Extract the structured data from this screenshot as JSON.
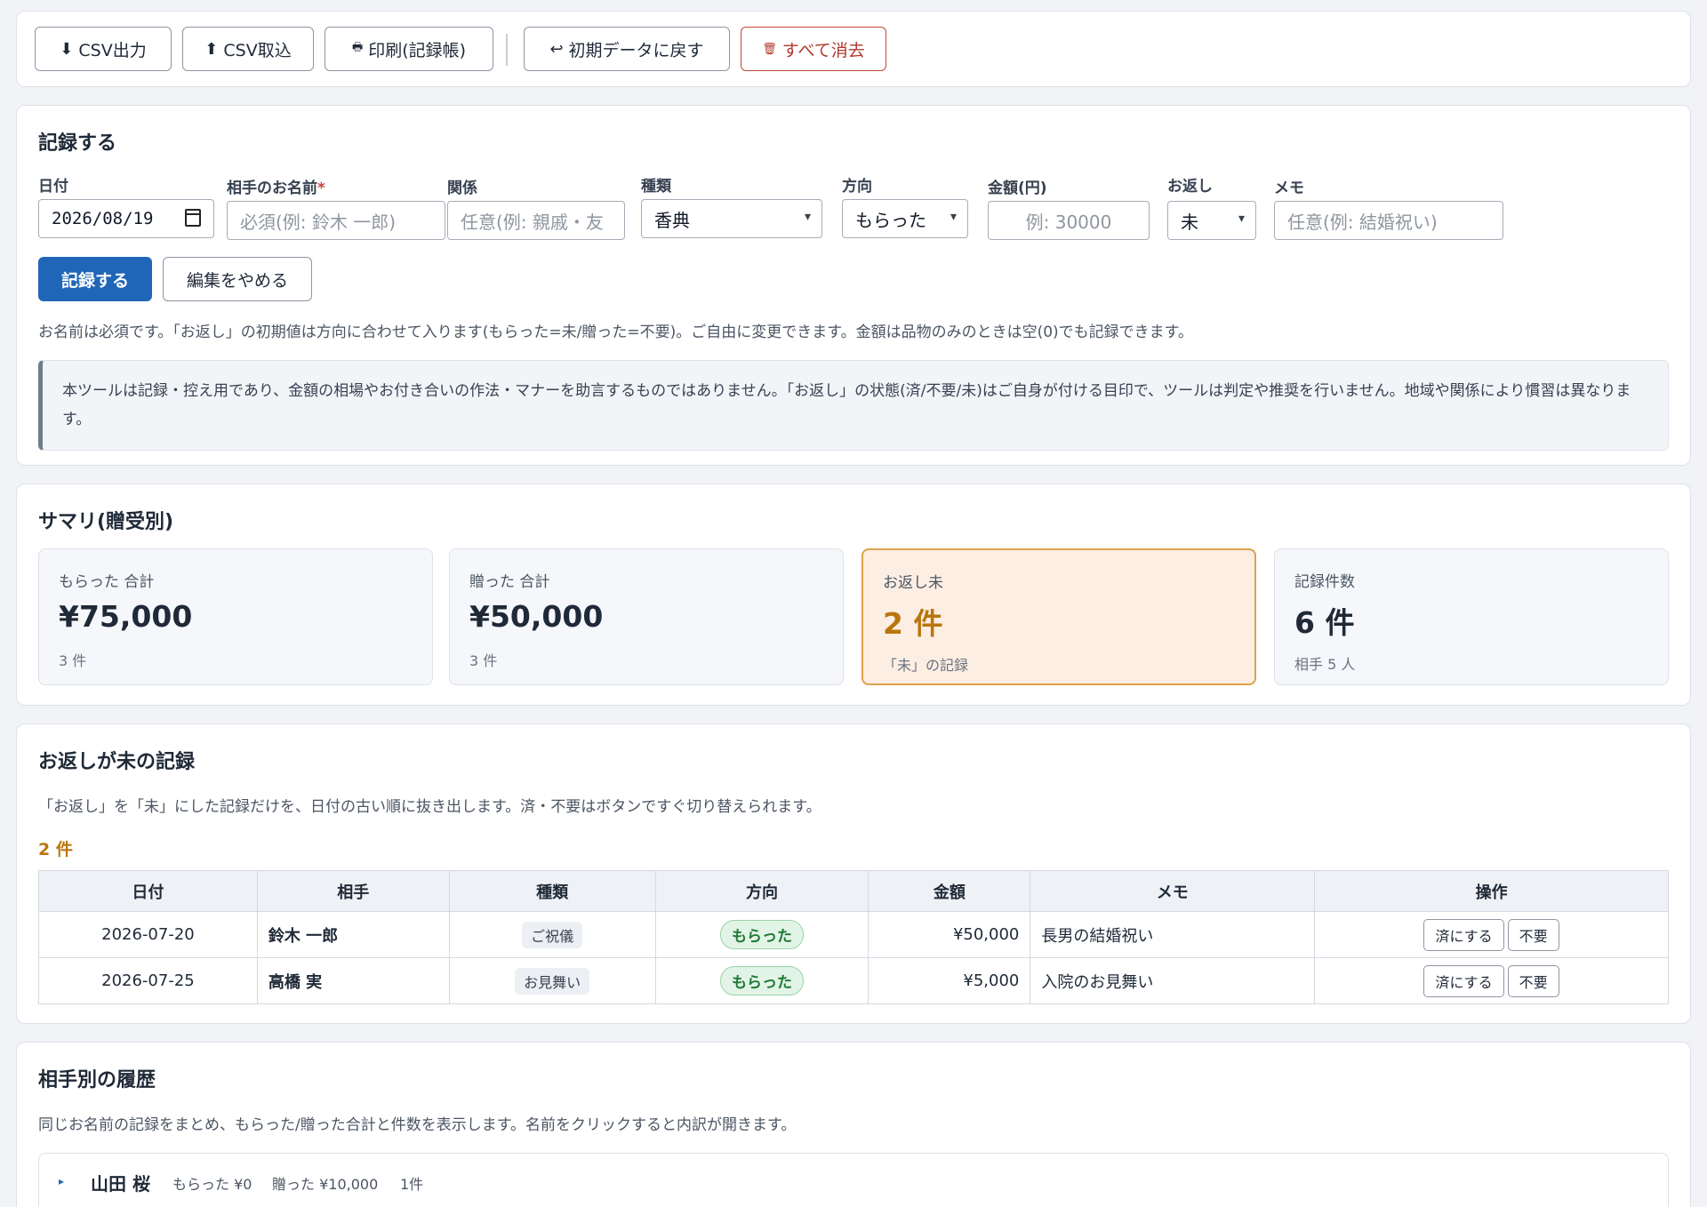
{
  "toolbar": {
    "csv_export": "CSV出力",
    "csv_import": "CSV取込",
    "print": "印刷(記録帳)",
    "reset": "初期データに戻す",
    "clear_all": "すべて消去"
  },
  "form": {
    "title": "記録する",
    "date_label": "日付",
    "date_value": "2026/08/19",
    "name_label": "相手のお名前",
    "name_required_mark": "*",
    "name_placeholder": "必須(例: 鈴木 一郎)",
    "relation_label": "関係",
    "relation_placeholder": "任意(例: 親戚・友",
    "type_label": "種類",
    "type_value": "香典",
    "direction_label": "方向",
    "direction_value": "もらった",
    "amount_label": "金額(円)",
    "amount_placeholder": "例: 30000",
    "return_label": "お返し",
    "return_value": "未",
    "memo_label": "メモ",
    "memo_placeholder": "任意(例: 結婚祝い)",
    "submit_label": "記録する",
    "cancel_label": "編集をやめる",
    "note": "お名前は必須です。「お返し」の初期値は方向に合わせて入ります(もらった=未/贈った=不要)。ご自由に変更できます。金額は品物のみのときは空(0)でも記録できます。",
    "disclaimer": "本ツールは記録・控え用であり、金額の相場やお付き合いの作法・マナーを助言するものではありません。「お返し」の状態(済/不要/未)はご自身が付ける目印で、ツールは判定や推奨を行いません。地域や関係により慣習は異なります。"
  },
  "summary": {
    "title": "サマリ(贈受別)",
    "received": {
      "label": "もらった 合計",
      "value": "¥75,000",
      "sub": "3 件"
    },
    "given": {
      "label": "贈った 合計",
      "value": "¥50,000",
      "sub": "3 件"
    },
    "pending": {
      "label": "お返し未",
      "value": "2 件",
      "sub": "「未」の記録"
    },
    "records": {
      "label": "記録件数",
      "value": "6 件",
      "sub": "相手 5 人"
    }
  },
  "pending_section": {
    "title": "お返しが未の記録",
    "description": "「お返し」を「未」にした記録だけを、日付の古い順に抜き出します。済・不要はボタンですぐ切り替えられます。",
    "count": "2 件",
    "headers": [
      "日付",
      "相手",
      "種類",
      "方向",
      "金額",
      "メモ",
      "操作"
    ],
    "done_label": "済にする",
    "none_label": "不要",
    "rows": [
      {
        "date": "2026-07-20",
        "name": "鈴木 一郎",
        "type": "ご祝儀",
        "direction": "もらった",
        "amount": "¥50,000",
        "memo": "長男の結婚祝い"
      },
      {
        "date": "2026-07-25",
        "name": "高橋 実",
        "type": "お見舞い",
        "direction": "もらった",
        "amount": "¥5,000",
        "memo": "入院のお見舞い"
      }
    ]
  },
  "history": {
    "title": "相手別の履歴",
    "description": "同じお名前の記録をまとめ、もらった/贈った合計と件数を表示します。名前をクリックすると内訳が開きます。",
    "rows": [
      {
        "name": "山田 桜",
        "received": "もらった ¥0",
        "given": "贈った ¥10,000",
        "count": "1件"
      }
    ]
  }
}
